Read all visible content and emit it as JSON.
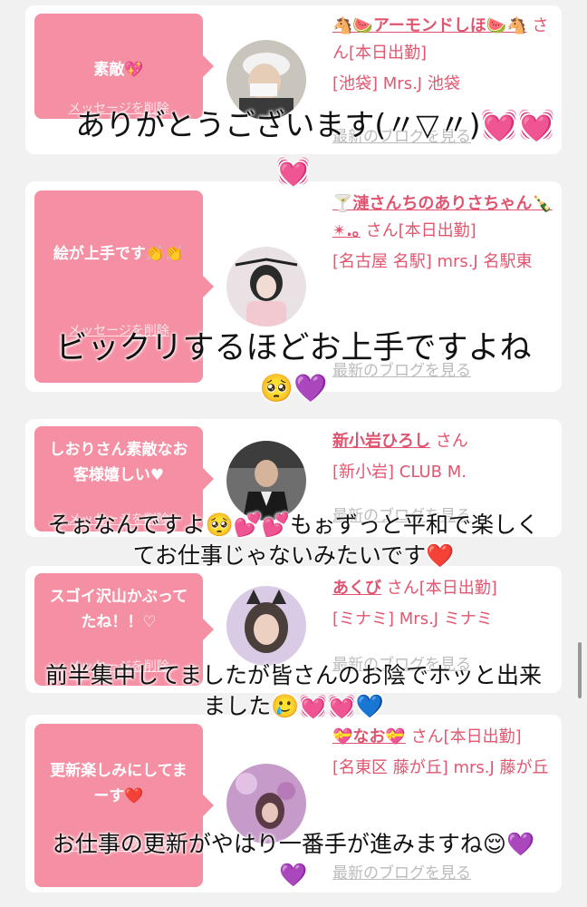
{
  "cards": [
    {
      "message": "素敵💖",
      "delete_label": "メッセージを削除",
      "name": "🐴🍉アーモンドしほ🍉🐴",
      "san": "さん[本日出勤]",
      "shop": "[池袋] Mrs.J 池袋",
      "blog": "最新のブログを見る"
    },
    {
      "message": "絵が上手です👏👏",
      "delete_label": "メッセージを削除",
      "name": "🍸漣さんちのありさちゃん🍾✴︎.｡",
      "san": "さん[本日出勤]",
      "shop": "[名古屋 名駅] mrs.J 名駅東",
      "blog": "最新のブログを見る"
    },
    {
      "message": "しおりさん素敵なお客様嬉しい♥",
      "delete_label": "メッセージを削除",
      "name": "新小岩ひろし",
      "san": "さん",
      "shop": "[新小岩] CLUB M.",
      "blog": "最新のブログを見る"
    },
    {
      "message": "スゴイ沢山かぶってたね！！♡",
      "delete_label": "メッセージを削除",
      "name": "あくび",
      "san": "さん[本日出勤]",
      "shop": "[ミナミ] Mrs.J ミナミ",
      "blog": "最新のブログを見る"
    },
    {
      "message": "更新楽しみにしてまーす❤️",
      "delete_label": "メッセージを削除",
      "name": "💝なお💝",
      "san": "さん[本日出勤]",
      "shop": "[名東区 藤が丘] mrs.J 藤が丘",
      "blog": "最新のブログを見る"
    }
  ],
  "overlays": {
    "o1_line1": "ありがとうございます(〃▽〃)",
    "o1_emoji": "💓💓",
    "o2_line1": "ビックリするほどお上手ですよね",
    "o2_emoji": "🥺💜",
    "o3_line1": "そぉなんですよ🥺💕💕もぉずっと平和で楽しく",
    "o3_line2": "てお仕事じゃないみたいです",
    "o3_emoji": "❤️",
    "o4_line1": "前半集中してましたが皆さんのお陰でホッと出来",
    "o4_line2": "ました🥲",
    "o4_emoji": "💓💓💙",
    "o5_line1": "お仕事の更新がやはり一番手が進みますね😌",
    "o5_emoji1": "💜",
    "o5_emoji2": "💜"
  }
}
